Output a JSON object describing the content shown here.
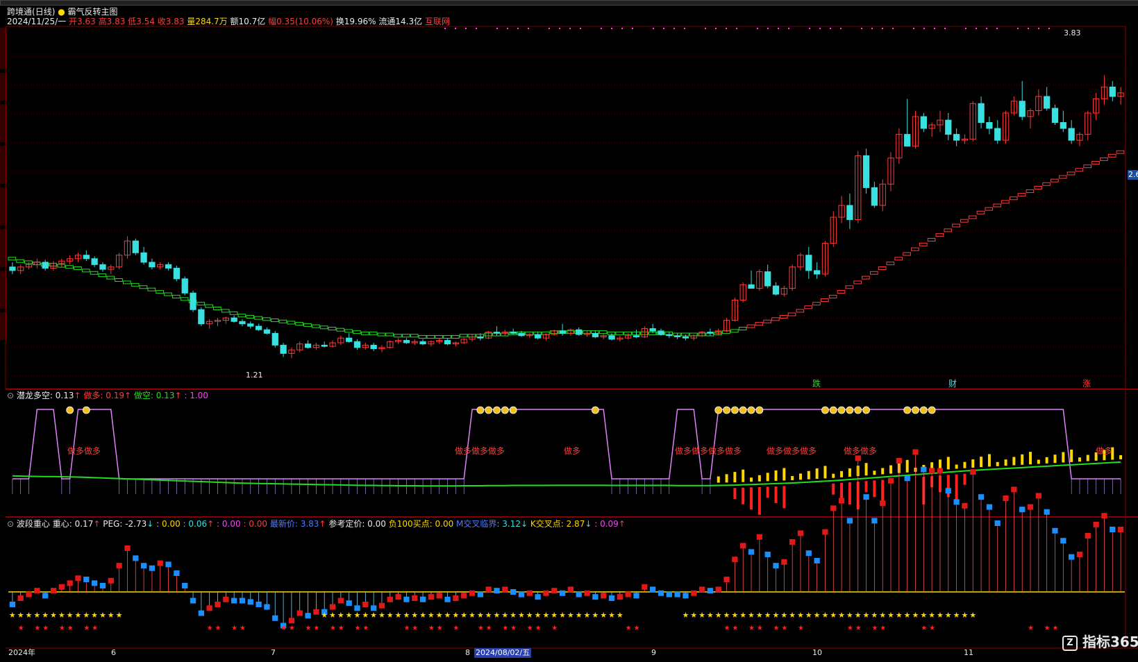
{
  "header": {
    "app": "跨境通",
    "period": "(日线)",
    "indicator_name": "霸气反转主图",
    "date": "2024/11/25/一",
    "open_label": "开",
    "open": "3.63",
    "high_label": "高",
    "high": "3.83",
    "low_label": "低",
    "low": "3.54",
    "close_label": "收",
    "close": "3.83",
    "vol_label": "量",
    "vol": "284.7万",
    "amount_label": "额",
    "amount": "10.7亿",
    "amp_label": "幅",
    "amp": "0.35(10.06%)",
    "turnover_label": "换",
    "turnover": "19.96%",
    "float_label": "流通",
    "float": "14.3亿",
    "sector": "互联网"
  },
  "main_chart_labels": {
    "high_marker": "3.83",
    "low_marker": "1.21",
    "tag1": "跌",
    "tag2": "财",
    "tag3": "涨"
  },
  "panel2": {
    "name": "潜龙多空",
    "v1": ": 0.13",
    "v1_arrow": "↑",
    "v2_label": "做多",
    "v2": ": 0.19",
    "v2_arrow": "↑",
    "v3_label": "做空",
    "v3": ": 0.13",
    "v3_arrow": "↑",
    "v4": ": 1.00",
    "signal_text": "做多"
  },
  "panel3": {
    "name": "波段重心",
    "zx_label": "重心",
    "zx": ": 0.17",
    "zx_arrow": "↑",
    "peg_label": "PEG",
    "peg": ": -2.73",
    "peg_arrow": "↓",
    "a1": ": 0.00",
    "a2": ": 0.06",
    "a2_arrow": "↑",
    "a3": ": 0.00",
    "a4": ": 0.00",
    "latest_label": "最新价",
    "latest": ": 3.83",
    "latest_arrow": "↑",
    "ref_label": "参考定价",
    "ref": ": 0.00",
    "buy_label": "负100买点",
    "buy": ": 0.00",
    "m_label": "M交叉临界",
    "m": ": 3.12",
    "m_arrow": "↓",
    "k_label": "K交叉点",
    "k": ": 2.87",
    "k_arrow": "↓",
    "e": ": 0.09",
    "e_arrow": "↑"
  },
  "xaxis": {
    "labels": [
      "2024年",
      "6",
      "7",
      "8",
      "9",
      "10",
      "11"
    ],
    "cursor_date": "2024/08/02/五"
  },
  "right_axis": {
    "marker": "2.6"
  },
  "watermark": "指标365",
  "colors": {
    "up": "#ff3b3b",
    "down": "#39e0e0",
    "ma_green": "#22dd22",
    "ma_red": "#ff3b3b",
    "signal_magenta": "#ff40ff",
    "yellow": "#ffd700",
    "grid": "#6b0000"
  },
  "chart_data": {
    "type": "candlestick",
    "title": "霸气反转主图",
    "x_range": [
      "2024-05",
      "2024-11-25"
    ],
    "ylim": [
      1.0,
      4.0
    ],
    "ohlc": [
      [
        1.98,
        2.02,
        1.92,
        1.95
      ],
      [
        1.95,
        2.0,
        1.92,
        1.98
      ],
      [
        1.98,
        2.02,
        1.96,
        2.0
      ],
      [
        2.0,
        2.05,
        1.97,
        2.02
      ],
      [
        2.02,
        2.04,
        1.95,
        1.97
      ],
      [
        1.97,
        2.03,
        1.95,
        2.01
      ],
      [
        2.01,
        2.05,
        1.98,
        2.03
      ],
      [
        2.03,
        2.08,
        2.0,
        2.05
      ],
      [
        2.05,
        2.1,
        2.02,
        2.08
      ],
      [
        2.08,
        2.12,
        2.03,
        2.05
      ],
      [
        2.05,
        2.07,
        1.98,
        2.0
      ],
      [
        2.0,
        2.02,
        1.94,
        1.96
      ],
      [
        1.96,
        2.0,
        1.92,
        1.98
      ],
      [
        1.98,
        2.1,
        1.96,
        2.08
      ],
      [
        2.08,
        2.24,
        2.05,
        2.2
      ],
      [
        2.2,
        2.22,
        2.08,
        2.1
      ],
      [
        2.1,
        2.15,
        2.0,
        2.02
      ],
      [
        2.02,
        2.05,
        1.96,
        1.98
      ],
      [
        1.98,
        2.02,
        1.96,
        2.0
      ],
      [
        2.0,
        2.02,
        1.95,
        1.97
      ],
      [
        1.97,
        1.99,
        1.86,
        1.88
      ],
      [
        1.88,
        1.9,
        1.74,
        1.76
      ],
      [
        1.76,
        1.78,
        1.6,
        1.62
      ],
      [
        1.62,
        1.64,
        1.48,
        1.5
      ],
      [
        1.5,
        1.54,
        1.46,
        1.52
      ],
      [
        1.52,
        1.55,
        1.48,
        1.53
      ],
      [
        1.53,
        1.56,
        1.5,
        1.55
      ],
      [
        1.55,
        1.57,
        1.51,
        1.52
      ],
      [
        1.52,
        1.54,
        1.48,
        1.5
      ],
      [
        1.5,
        1.52,
        1.46,
        1.48
      ],
      [
        1.48,
        1.5,
        1.44,
        1.45
      ],
      [
        1.45,
        1.47,
        1.41,
        1.42
      ],
      [
        1.42,
        1.44,
        1.3,
        1.32
      ],
      [
        1.32,
        1.34,
        1.22,
        1.25
      ],
      [
        1.25,
        1.3,
        1.21,
        1.28
      ],
      [
        1.28,
        1.35,
        1.26,
        1.33
      ],
      [
        1.33,
        1.36,
        1.29,
        1.3
      ],
      [
        1.3,
        1.34,
        1.28,
        1.32
      ],
      [
        1.32,
        1.35,
        1.3,
        1.31
      ],
      [
        1.31,
        1.36,
        1.3,
        1.34
      ],
      [
        1.34,
        1.4,
        1.32,
        1.38
      ],
      [
        1.38,
        1.42,
        1.34,
        1.35
      ],
      [
        1.35,
        1.37,
        1.28,
        1.3
      ],
      [
        1.3,
        1.34,
        1.28,
        1.32
      ],
      [
        1.32,
        1.34,
        1.27,
        1.29
      ],
      [
        1.29,
        1.32,
        1.26,
        1.3
      ],
      [
        1.3,
        1.36,
        1.29,
        1.35
      ],
      [
        1.35,
        1.38,
        1.33,
        1.36
      ],
      [
        1.36,
        1.38,
        1.33,
        1.34
      ],
      [
        1.34,
        1.37,
        1.32,
        1.35
      ],
      [
        1.35,
        1.37,
        1.32,
        1.33
      ],
      [
        1.33,
        1.36,
        1.31,
        1.35
      ],
      [
        1.35,
        1.38,
        1.33,
        1.36
      ],
      [
        1.36,
        1.38,
        1.32,
        1.33
      ],
      [
        1.33,
        1.35,
        1.31,
        1.34
      ],
      [
        1.34,
        1.38,
        1.33,
        1.37
      ],
      [
        1.37,
        1.41,
        1.35,
        1.39
      ],
      [
        1.39,
        1.42,
        1.36,
        1.38
      ],
      [
        1.38,
        1.44,
        1.37,
        1.43
      ],
      [
        1.43,
        1.48,
        1.4,
        1.42
      ],
      [
        1.42,
        1.45,
        1.4,
        1.43
      ],
      [
        1.43,
        1.46,
        1.41,
        1.42
      ],
      [
        1.42,
        1.44,
        1.39,
        1.4
      ],
      [
        1.4,
        1.42,
        1.38,
        1.41
      ],
      [
        1.41,
        1.43,
        1.37,
        1.38
      ],
      [
        1.38,
        1.42,
        1.36,
        1.41
      ],
      [
        1.41,
        1.45,
        1.4,
        1.44
      ],
      [
        1.44,
        1.5,
        1.4,
        1.42
      ],
      [
        1.42,
        1.46,
        1.4,
        1.45
      ],
      [
        1.45,
        1.47,
        1.4,
        1.41
      ],
      [
        1.41,
        1.44,
        1.39,
        1.42
      ],
      [
        1.42,
        1.44,
        1.38,
        1.39
      ],
      [
        1.39,
        1.42,
        1.37,
        1.4
      ],
      [
        1.4,
        1.42,
        1.36,
        1.37
      ],
      [
        1.37,
        1.4,
        1.35,
        1.38
      ],
      [
        1.38,
        1.42,
        1.37,
        1.4
      ],
      [
        1.4,
        1.45,
        1.38,
        1.39
      ],
      [
        1.39,
        1.48,
        1.38,
        1.46
      ],
      [
        1.46,
        1.5,
        1.42,
        1.44
      ],
      [
        1.44,
        1.46,
        1.4,
        1.41
      ],
      [
        1.41,
        1.43,
        1.38,
        1.4
      ],
      [
        1.4,
        1.42,
        1.37,
        1.39
      ],
      [
        1.39,
        1.41,
        1.36,
        1.38
      ],
      [
        1.38,
        1.41,
        1.36,
        1.4
      ],
      [
        1.4,
        1.44,
        1.39,
        1.43
      ],
      [
        1.43,
        1.46,
        1.4,
        1.42
      ],
      [
        1.42,
        1.46,
        1.4,
        1.44
      ],
      [
        1.44,
        1.55,
        1.43,
        1.53
      ],
      [
        1.53,
        1.72,
        1.52,
        1.7
      ],
      [
        1.7,
        1.85,
        1.68,
        1.83
      ],
      [
        1.83,
        1.95,
        1.8,
        1.8
      ],
      [
        1.8,
        1.96,
        1.78,
        1.94
      ],
      [
        1.94,
        2.0,
        1.8,
        1.82
      ],
      [
        1.82,
        1.85,
        1.74,
        1.75
      ],
      [
        1.75,
        1.82,
        1.73,
        1.8
      ],
      [
        1.8,
        2.0,
        1.78,
        1.98
      ],
      [
        1.98,
        2.1,
        1.95,
        2.08
      ],
      [
        2.08,
        2.15,
        1.88,
        1.95
      ],
      [
        1.95,
        2.02,
        1.88,
        1.92
      ],
      [
        1.92,
        2.2,
        1.9,
        2.18
      ],
      [
        2.18,
        2.45,
        2.15,
        2.4
      ],
      [
        2.4,
        2.58,
        2.35,
        2.5
      ],
      [
        2.5,
        2.6,
        2.3,
        2.38
      ],
      [
        2.38,
        2.96,
        2.35,
        2.92
      ],
      [
        2.92,
        2.98,
        2.6,
        2.65
      ],
      [
        2.65,
        2.7,
        2.48,
        2.5
      ],
      [
        2.5,
        2.72,
        2.45,
        2.68
      ],
      [
        2.68,
        2.95,
        2.62,
        2.9
      ],
      [
        2.9,
        3.15,
        2.85,
        3.1
      ],
      [
        3.1,
        3.4,
        3.02,
        3.0
      ],
      [
        3.0,
        3.3,
        2.98,
        3.25
      ],
      [
        3.25,
        3.28,
        3.12,
        3.15
      ],
      [
        3.15,
        3.2,
        3.08,
        3.18
      ],
      [
        3.18,
        3.3,
        3.12,
        3.22
      ],
      [
        3.22,
        3.28,
        3.05,
        3.1
      ],
      [
        3.1,
        3.15,
        3.0,
        3.05
      ],
      [
        3.05,
        3.1,
        3.02,
        3.06
      ],
      [
        3.06,
        3.38,
        3.04,
        3.36
      ],
      [
        3.36,
        3.42,
        3.15,
        3.2
      ],
      [
        3.2,
        3.25,
        3.1,
        3.15
      ],
      [
        3.15,
        3.22,
        3.02,
        3.05
      ],
      [
        3.05,
        3.3,
        3.02,
        3.28
      ],
      [
        3.28,
        3.42,
        3.26,
        3.38
      ],
      [
        3.38,
        3.55,
        3.22,
        3.25
      ],
      [
        3.25,
        3.32,
        3.15,
        3.3
      ],
      [
        3.3,
        3.48,
        3.26,
        3.42
      ],
      [
        3.42,
        3.5,
        3.3,
        3.32
      ],
      [
        3.32,
        3.35,
        3.18,
        3.2
      ],
      [
        3.2,
        3.3,
        3.12,
        3.15
      ],
      [
        3.15,
        3.22,
        3.02,
        3.05
      ],
      [
        3.05,
        3.12,
        3.0,
        3.1
      ],
      [
        3.1,
        3.3,
        3.05,
        3.28
      ],
      [
        3.28,
        3.45,
        3.22,
        3.4
      ],
      [
        3.4,
        3.6,
        3.35,
        3.5
      ],
      [
        3.5,
        3.55,
        3.38,
        3.42
      ],
      [
        3.42,
        3.5,
        3.35,
        3.45
      ]
    ],
    "ma_line": [
      2.05,
      2.03,
      2.02,
      2.01,
      2.0,
      2.0,
      1.99,
      1.98,
      1.97,
      1.95,
      1.93,
      1.91,
      1.89,
      1.87,
      1.85,
      1.83,
      1.81,
      1.79,
      1.77,
      1.75,
      1.73,
      1.71,
      1.69,
      1.67,
      1.65,
      1.63,
      1.61,
      1.59,
      1.57,
      1.56,
      1.55,
      1.54,
      1.53,
      1.52,
      1.51,
      1.5,
      1.49,
      1.48,
      1.47,
      1.46,
      1.45,
      1.44,
      1.43,
      1.42,
      1.42,
      1.41,
      1.41,
      1.4,
      1.4,
      1.4,
      1.39,
      1.39,
      1.39,
      1.39,
      1.39,
      1.4,
      1.4,
      1.4,
      1.41,
      1.41,
      1.41,
      1.42,
      1.42,
      1.42,
      1.42,
      1.42,
      1.43,
      1.43,
      1.43,
      1.43,
      1.43,
      1.43,
      1.43,
      1.42,
      1.42,
      1.42,
      1.42,
      1.42,
      1.42,
      1.42,
      1.42,
      1.41,
      1.41,
      1.41,
      1.41,
      1.41,
      1.42,
      1.43,
      1.44,
      1.46,
      1.48,
      1.5,
      1.52,
      1.54,
      1.56,
      1.58,
      1.61,
      1.64,
      1.67,
      1.7,
      1.73,
      1.77,
      1.81,
      1.85,
      1.89,
      1.93,
      1.97,
      2.01,
      2.05,
      2.09,
      2.13,
      2.17,
      2.21,
      2.25,
      2.29,
      2.33,
      2.37,
      2.4,
      2.44,
      2.47,
      2.5,
      2.53,
      2.56,
      2.59,
      2.62,
      2.65,
      2.68,
      2.71,
      2.74,
      2.77,
      2.8,
      2.83,
      2.86,
      2.89,
      2.92,
      2.95,
      2.98,
      3.01,
      3.04,
      3.06,
      3.08,
      3.1
    ]
  }
}
